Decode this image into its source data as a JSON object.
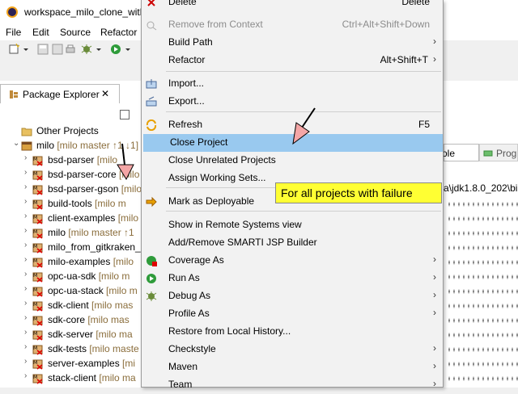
{
  "window": {
    "title": "workspace_milo_clone_with"
  },
  "menubar": {
    "items": [
      "File",
      "Edit",
      "Source",
      "Refactor"
    ]
  },
  "package_explorer": {
    "tab_label": "Package Explorer",
    "close_glyph": "✕",
    "tree": [
      {
        "name": "Other Projects",
        "decor": "",
        "indent": 0,
        "expanded": false,
        "arrow": "",
        "icon": "folder-icon"
      },
      {
        "name": "milo",
        "decor": " [milo master ↑1 ↓1]",
        "indent": 0,
        "expanded": true,
        "arrow": "⌄",
        "icon": "project-icon"
      },
      {
        "name": "bsd-parser",
        "decor": " [milo",
        "indent": 1,
        "arrow": "›",
        "icon": "maven-project-icon"
      },
      {
        "name": "bsd-parser-core",
        "decor": " [milo",
        "indent": 1,
        "arrow": "›",
        "icon": "maven-project-icon"
      },
      {
        "name": "bsd-parser-gson",
        "decor": " [milo",
        "indent": 1,
        "arrow": "›",
        "icon": "maven-project-icon"
      },
      {
        "name": "build-tools",
        "decor": " [milo m",
        "indent": 1,
        "arrow": "›",
        "icon": "maven-project-icon"
      },
      {
        "name": "client-examples",
        "decor": " [milo",
        "indent": 1,
        "arrow": "›",
        "icon": "maven-project-icon"
      },
      {
        "name": "milo",
        "decor": " [milo master ↑1",
        "indent": 1,
        "arrow": "›",
        "icon": "maven-project-icon"
      },
      {
        "name": "milo_from_gitkraken_",
        "decor": "",
        "indent": 1,
        "arrow": "›",
        "icon": "maven-project-icon"
      },
      {
        "name": "milo-examples",
        "decor": " [milo",
        "indent": 1,
        "arrow": "›",
        "icon": "maven-project-icon"
      },
      {
        "name": "opc-ua-sdk",
        "decor": " [milo m",
        "indent": 1,
        "arrow": "›",
        "icon": "maven-project-icon"
      },
      {
        "name": "opc-ua-stack",
        "decor": " [milo m",
        "indent": 1,
        "arrow": "›",
        "icon": "maven-project-icon"
      },
      {
        "name": "sdk-client",
        "decor": " [milo mas",
        "indent": 1,
        "arrow": "›",
        "icon": "maven-project-icon"
      },
      {
        "name": "sdk-core",
        "decor": " [milo mas",
        "indent": 1,
        "arrow": "›",
        "icon": "maven-project-icon"
      },
      {
        "name": "sdk-server",
        "decor": " [milo ma",
        "indent": 1,
        "arrow": "›",
        "icon": "maven-project-icon"
      },
      {
        "name": "sdk-tests",
        "decor": " [milo maste",
        "indent": 1,
        "arrow": "›",
        "icon": "maven-project-icon"
      },
      {
        "name": "server-examples",
        "decor": " [mi",
        "indent": 1,
        "arrow": "›",
        "icon": "maven-project-icon"
      },
      {
        "name": "stack-client",
        "decor": " [milo ma",
        "indent": 1,
        "arrow": "›",
        "icon": "maven-project-icon"
      }
    ]
  },
  "editor": {
    "tab1_label": "ole",
    "tab2_label": "Prog",
    "path_text": "a\\jdk1.8.0_202\\bi"
  },
  "context_menu": {
    "items": [
      {
        "id": "delete",
        "label": "Delete",
        "shortcut": "Delete",
        "submenu": false,
        "icon": "delete-icon",
        "disabled": false
      },
      {
        "id": "remove-from-context",
        "label": "Remove from Context",
        "shortcut": "Ctrl+Alt+Shift+Down",
        "submenu": false,
        "icon": "remove-context-icon",
        "disabled": true
      },
      {
        "id": "build-path",
        "label": "Build Path",
        "shortcut": "",
        "submenu": true,
        "icon": "",
        "disabled": false
      },
      {
        "id": "refactor",
        "label": "Refactor",
        "shortcut": "Alt+Shift+T",
        "submenu": true,
        "icon": "",
        "disabled": false
      },
      {
        "id": "import",
        "label": "Import...",
        "shortcut": "",
        "submenu": false,
        "icon": "import-icon",
        "disabled": false
      },
      {
        "id": "export",
        "label": "Export...",
        "shortcut": "",
        "submenu": false,
        "icon": "export-icon",
        "disabled": false
      },
      {
        "id": "refresh",
        "label": "Refresh",
        "shortcut": "F5",
        "submenu": false,
        "icon": "refresh-icon",
        "disabled": false
      },
      {
        "id": "close-project",
        "label": "Close Project",
        "shortcut": "",
        "submenu": false,
        "icon": "",
        "disabled": false,
        "highlighted": true
      },
      {
        "id": "close-unrelated-projects",
        "label": "Close Unrelated Projects",
        "shortcut": "",
        "submenu": false,
        "icon": "",
        "disabled": false
      },
      {
        "id": "assign-working-sets",
        "label": "Assign Working Sets...",
        "shortcut": "",
        "submenu": false,
        "icon": "",
        "disabled": false
      },
      {
        "id": "mark-as-deployable",
        "label": "Mark as Deployable",
        "shortcut": "",
        "submenu": false,
        "icon": "deployable-icon",
        "disabled": false
      },
      {
        "id": "show-in-remote-systems",
        "label": "Show in Remote Systems view",
        "shortcut": "",
        "submenu": false,
        "icon": "",
        "disabled": false
      },
      {
        "id": "add-remove-smarti",
        "label": "Add/Remove SMARTI JSP Builder",
        "shortcut": "",
        "submenu": false,
        "icon": "",
        "disabled": false
      },
      {
        "id": "coverage-as",
        "label": "Coverage As",
        "shortcut": "",
        "submenu": true,
        "icon": "coverage-icon",
        "disabled": false
      },
      {
        "id": "run-as",
        "label": "Run As",
        "shortcut": "",
        "submenu": true,
        "icon": "run-icon",
        "disabled": false
      },
      {
        "id": "debug-as",
        "label": "Debug As",
        "shortcut": "",
        "submenu": true,
        "icon": "debug-icon",
        "disabled": false
      },
      {
        "id": "profile-as",
        "label": "Profile As",
        "shortcut": "",
        "submenu": true,
        "icon": "",
        "disabled": false
      },
      {
        "id": "restore-local-history",
        "label": "Restore from Local History...",
        "shortcut": "",
        "submenu": false,
        "icon": "",
        "disabled": false
      },
      {
        "id": "checkstyle",
        "label": "Checkstyle",
        "shortcut": "",
        "submenu": true,
        "icon": "",
        "disabled": false
      },
      {
        "id": "maven",
        "label": "Maven",
        "shortcut": "",
        "submenu": true,
        "icon": "",
        "disabled": false
      },
      {
        "id": "team",
        "label": "Team",
        "shortcut": "",
        "submenu": true,
        "icon": "",
        "disabled": false
      }
    ]
  },
  "callout": {
    "text": "For all projects with failure"
  },
  "colors": {
    "highlight": "#99c9ef",
    "callout": "#ffff33",
    "arrow_fill": "#f4a6a6",
    "decoration": "#8a6d3b"
  }
}
